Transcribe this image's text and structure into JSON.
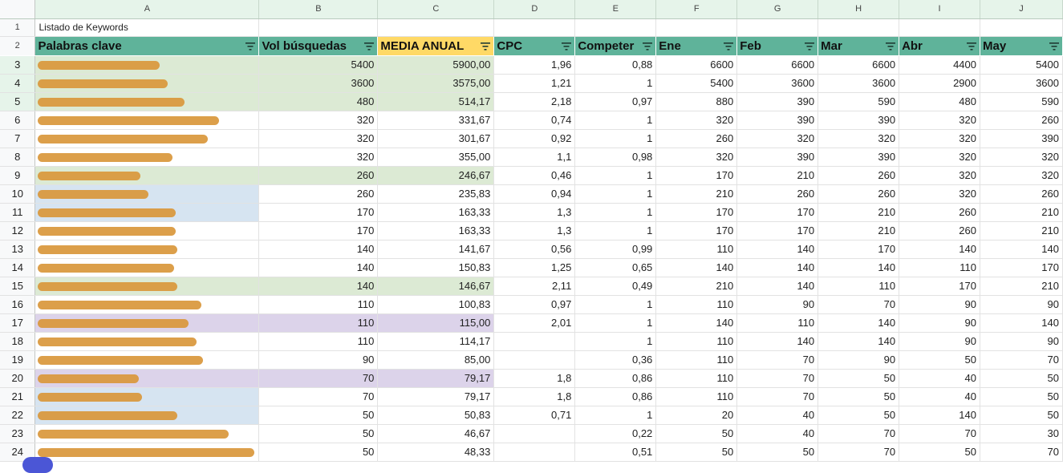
{
  "sheet": {
    "column_letters": [
      "A",
      "B",
      "C",
      "D",
      "E",
      "F",
      "G",
      "H",
      "I",
      "J"
    ],
    "row_numbers": [
      "1",
      "2",
      "3",
      "4",
      "5",
      "6",
      "7",
      "8",
      "9",
      "10",
      "11",
      "12",
      "13",
      "14",
      "15",
      "16",
      "17",
      "18",
      "19",
      "20",
      "21",
      "22",
      "23",
      "24"
    ],
    "title_cell": "Listado de Keywords",
    "headers": [
      "Palabras clave",
      "Vol búsquedas",
      "MEDIA ANUAL",
      "CPC",
      "Competer",
      "Ene",
      "Feb",
      "Mar",
      "Abr",
      "May"
    ],
    "rows": [
      {
        "vol": "5400",
        "media": "5900,00",
        "cpc": "1,96",
        "comp": "0,88",
        "ene": "6600",
        "feb": "6600",
        "mar": "6600",
        "abr": "4400",
        "may": "5400"
      },
      {
        "vol": "3600",
        "media": "3575,00",
        "cpc": "1,21",
        "comp": "1",
        "ene": "5400",
        "feb": "3600",
        "mar": "3600",
        "abr": "2900",
        "may": "3600"
      },
      {
        "vol": "480",
        "media": "514,17",
        "cpc": "2,18",
        "comp": "0,97",
        "ene": "880",
        "feb": "390",
        "mar": "590",
        "abr": "480",
        "may": "590"
      },
      {
        "vol": "320",
        "media": "331,67",
        "cpc": "0,74",
        "comp": "1",
        "ene": "320",
        "feb": "390",
        "mar": "390",
        "abr": "320",
        "may": "260"
      },
      {
        "vol": "320",
        "media": "301,67",
        "cpc": "0,92",
        "comp": "1",
        "ene": "260",
        "feb": "320",
        "mar": "320",
        "abr": "320",
        "may": "390"
      },
      {
        "vol": "320",
        "media": "355,00",
        "cpc": "1,1",
        "comp": "0,98",
        "ene": "320",
        "feb": "390",
        "mar": "390",
        "abr": "320",
        "may": "320"
      },
      {
        "vol": "260",
        "media": "246,67",
        "cpc": "0,46",
        "comp": "1",
        "ene": "170",
        "feb": "210",
        "mar": "260",
        "abr": "320",
        "may": "320"
      },
      {
        "vol": "260",
        "media": "235,83",
        "cpc": "0,94",
        "comp": "1",
        "ene": "210",
        "feb": "260",
        "mar": "260",
        "abr": "320",
        "may": "260"
      },
      {
        "vol": "170",
        "media": "163,33",
        "cpc": "1,3",
        "comp": "1",
        "ene": "170",
        "feb": "170",
        "mar": "210",
        "abr": "260",
        "may": "210"
      },
      {
        "vol": "170",
        "media": "163,33",
        "cpc": "1,3",
        "comp": "1",
        "ene": "170",
        "feb": "170",
        "mar": "210",
        "abr": "260",
        "may": "210"
      },
      {
        "vol": "140",
        "media": "141,67",
        "cpc": "0,56",
        "comp": "0,99",
        "ene": "110",
        "feb": "140",
        "mar": "170",
        "abr": "140",
        "may": "140"
      },
      {
        "vol": "140",
        "media": "150,83",
        "cpc": "1,25",
        "comp": "0,65",
        "ene": "140",
        "feb": "140",
        "mar": "140",
        "abr": "110",
        "may": "170"
      },
      {
        "vol": "140",
        "media": "146,67",
        "cpc": "2,11",
        "comp": "0,49",
        "ene": "210",
        "feb": "140",
        "mar": "110",
        "abr": "170",
        "may": "210"
      },
      {
        "vol": "110",
        "media": "100,83",
        "cpc": "0,97",
        "comp": "1",
        "ene": "110",
        "feb": "90",
        "mar": "70",
        "abr": "90",
        "may": "90"
      },
      {
        "vol": "110",
        "media": "115,00",
        "cpc": "2,01",
        "comp": "1",
        "ene": "140",
        "feb": "110",
        "mar": "140",
        "abr": "90",
        "may": "140"
      },
      {
        "vol": "110",
        "media": "114,17",
        "cpc": "",
        "comp": "1",
        "ene": "110",
        "feb": "140",
        "mar": "140",
        "abr": "90",
        "may": "90"
      },
      {
        "vol": "90",
        "media": "85,00",
        "cpc": "",
        "comp": "0,36",
        "ene": "110",
        "feb": "70",
        "mar": "90",
        "abr": "50",
        "may": "70"
      },
      {
        "vol": "70",
        "media": "79,17",
        "cpc": "1,8",
        "comp": "0,86",
        "ene": "110",
        "feb": "70",
        "mar": "50",
        "abr": "40",
        "may": "50"
      },
      {
        "vol": "70",
        "media": "79,17",
        "cpc": "1,8",
        "comp": "0,86",
        "ene": "110",
        "feb": "70",
        "mar": "50",
        "abr": "40",
        "may": "50"
      },
      {
        "vol": "50",
        "media": "50,83",
        "cpc": "0,71",
        "comp": "1",
        "ene": "20",
        "feb": "40",
        "mar": "50",
        "abr": "140",
        "may": "50"
      },
      {
        "vol": "50",
        "media": "46,67",
        "cpc": "",
        "comp": "0,22",
        "ene": "50",
        "feb": "40",
        "mar": "70",
        "abr": "70",
        "may": "30"
      },
      {
        "vol": "50",
        "media": "48,33",
        "cpc": "",
        "comp": "0,51",
        "ene": "50",
        "feb": "50",
        "mar": "70",
        "abr": "50",
        "may": "70"
      }
    ]
  },
  "colors": {
    "header_teal": "#5fb39a",
    "media_header_yellow": "#ffd966",
    "highlight_green": "#dcead4",
    "highlight_blue": "#d6e4f1",
    "highlight_purple": "#dcd3ea",
    "redaction_orange": "#d9973b"
  },
  "icons": {
    "column_filter": "filter-icon",
    "fab": "fab-button"
  }
}
